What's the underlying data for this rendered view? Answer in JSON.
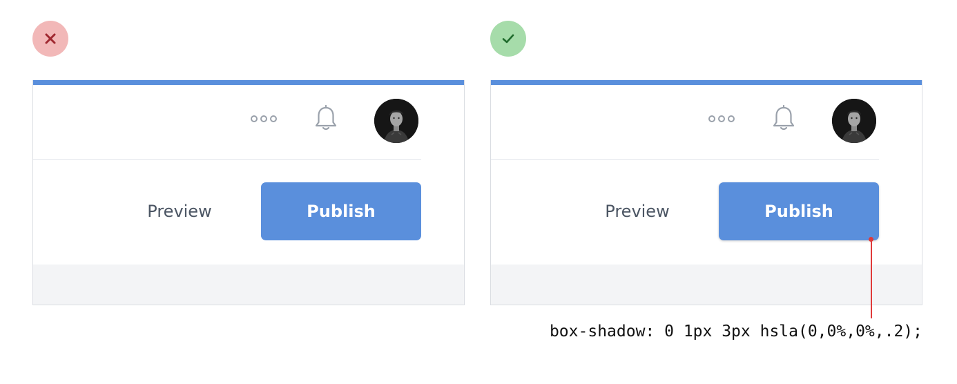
{
  "comparison": {
    "bad": {
      "status_icon": "close-icon",
      "status_color": "#f2b8b8",
      "icon_color": "#a02830",
      "header": {
        "more_icon": "more-dots-icon",
        "notification_icon": "bell-icon",
        "avatar": "user-avatar"
      },
      "actions": {
        "preview_label": "Preview",
        "publish_label": "Publish"
      },
      "has_shadow": false
    },
    "good": {
      "status_icon": "check-icon",
      "status_color": "#a6dcaa",
      "icon_color": "#1f6b2c",
      "header": {
        "more_icon": "more-dots-icon",
        "notification_icon": "bell-icon",
        "avatar": "user-avatar"
      },
      "actions": {
        "preview_label": "Preview",
        "publish_label": "Publish"
      },
      "has_shadow": true
    }
  },
  "colors": {
    "accent": "#5a8fdc",
    "callout": "#e03a3a",
    "footer_bg": "#f3f4f6"
  },
  "annotation": {
    "code": "box-shadow: 0 1px 3px hsla(0,0%,0%,.2);"
  }
}
